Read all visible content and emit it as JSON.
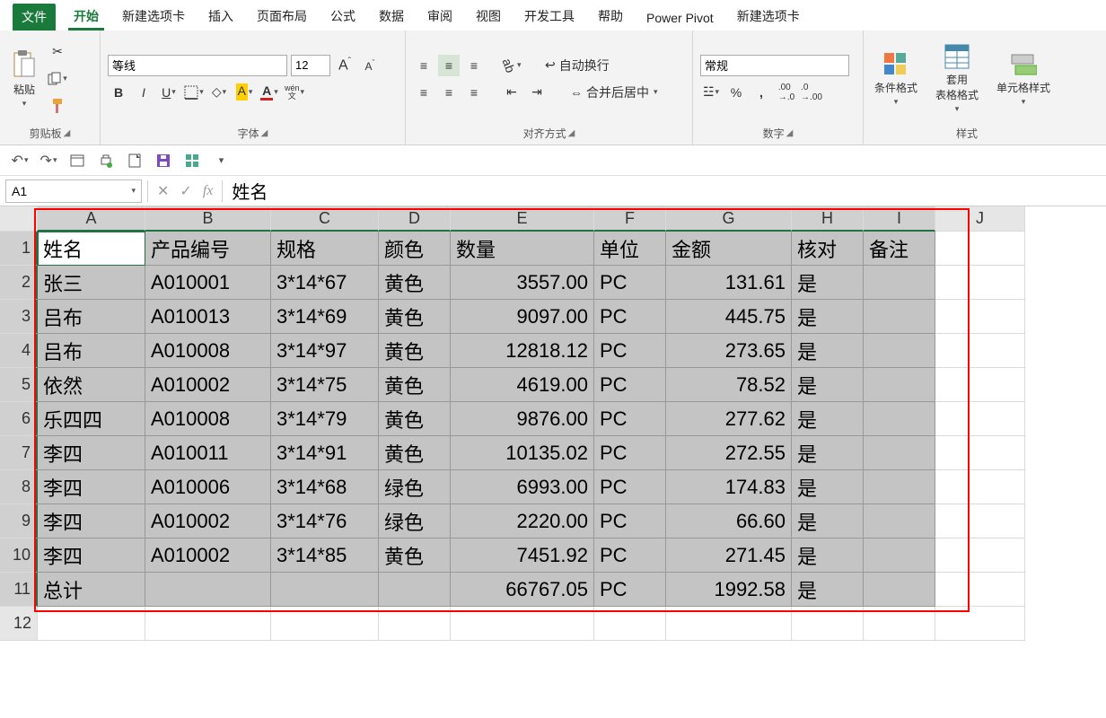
{
  "menu": {
    "file": "文件",
    "home": "开始",
    "newtab1": "新建选项卡",
    "insert": "插入",
    "layout": "页面布局",
    "formula": "公式",
    "data": "数据",
    "review": "审阅",
    "view": "视图",
    "dev": "开发工具",
    "help": "帮助",
    "powerpivot": "Power Pivot",
    "newtab2": "新建选项卡"
  },
  "ribbon": {
    "clipboard": {
      "label": "剪贴板",
      "paste": "粘贴"
    },
    "font": {
      "label": "字体",
      "name": "等线",
      "size": "12",
      "bold": "B",
      "italic": "I",
      "underline": "U",
      "wen": "wén",
      "wen2": "文"
    },
    "align": {
      "label": "对齐方式",
      "wrap": "自动换行",
      "merge": "合并后居中"
    },
    "number": {
      "label": "数字",
      "format": "常规"
    },
    "styles": {
      "label": "样式",
      "cond": "条件格式",
      "table": "套用\n表格格式",
      "cell": "单元格样式"
    }
  },
  "qat": {
    "items": [
      "undo",
      "redo",
      "save-mode",
      "touch",
      "new",
      "save",
      "grid",
      "more"
    ]
  },
  "namebox": "A1",
  "formula": "姓名",
  "columns": [
    "A",
    "B",
    "C",
    "D",
    "E",
    "F",
    "G",
    "H",
    "I",
    "J"
  ],
  "headers": [
    "姓名",
    "产品编号",
    "规格",
    "颜色",
    "数量",
    "单位",
    "金额",
    "核对",
    "备注"
  ],
  "rows": [
    {
      "r": 2,
      "c": [
        "张三",
        "A010001",
        "3*14*67",
        "黄色",
        "3557.00",
        "PC",
        "131.61",
        "是",
        ""
      ]
    },
    {
      "r": 3,
      "c": [
        "吕布",
        "A010013",
        "3*14*69",
        "黄色",
        "9097.00",
        "PC",
        "445.75",
        "是",
        ""
      ]
    },
    {
      "r": 4,
      "c": [
        "吕布",
        "A010008",
        "3*14*97",
        "黄色",
        "12818.12",
        "PC",
        "273.65",
        "是",
        ""
      ]
    },
    {
      "r": 5,
      "c": [
        "依然",
        "A010002",
        "3*14*75",
        "黄色",
        "4619.00",
        "PC",
        "78.52",
        "是",
        ""
      ]
    },
    {
      "r": 6,
      "c": [
        "乐四四",
        "A010008",
        "3*14*79",
        "黄色",
        "9876.00",
        "PC",
        "277.62",
        "是",
        ""
      ]
    },
    {
      "r": 7,
      "c": [
        "李四",
        "A010011",
        "3*14*91",
        "黄色",
        "10135.02",
        "PC",
        "272.55",
        "是",
        ""
      ]
    },
    {
      "r": 8,
      "c": [
        "李四",
        "A010006",
        "3*14*68",
        "绿色",
        "6993.00",
        "PC",
        "174.83",
        "是",
        ""
      ]
    },
    {
      "r": 9,
      "c": [
        "李四",
        "A010002",
        "3*14*76",
        "绿色",
        "2220.00",
        "PC",
        "66.60",
        "是",
        ""
      ]
    },
    {
      "r": 10,
      "c": [
        "李四",
        "A010002",
        "3*14*85",
        "黄色",
        "7451.92",
        "PC",
        "271.45",
        "是",
        ""
      ]
    },
    {
      "r": 11,
      "c": [
        "总计",
        "",
        "",
        "",
        "66767.05",
        "PC",
        "1992.58",
        "是",
        ""
      ]
    }
  ],
  "chart_data": {
    "type": "table",
    "columns": [
      "姓名",
      "产品编号",
      "规格",
      "颜色",
      "数量",
      "单位",
      "金额",
      "核对",
      "备注"
    ],
    "rows": [
      [
        "张三",
        "A010001",
        "3*14*67",
        "黄色",
        3557.0,
        "PC",
        131.61,
        "是",
        ""
      ],
      [
        "吕布",
        "A010013",
        "3*14*69",
        "黄色",
        9097.0,
        "PC",
        445.75,
        "是",
        ""
      ],
      [
        "吕布",
        "A010008",
        "3*14*97",
        "黄色",
        12818.12,
        "PC",
        273.65,
        "是",
        ""
      ],
      [
        "依然",
        "A010002",
        "3*14*75",
        "黄色",
        4619.0,
        "PC",
        78.52,
        "是",
        ""
      ],
      [
        "乐四四",
        "A010008",
        "3*14*79",
        "黄色",
        9876.0,
        "PC",
        277.62,
        "是",
        ""
      ],
      [
        "李四",
        "A010011",
        "3*14*91",
        "黄色",
        10135.02,
        "PC",
        272.55,
        "是",
        ""
      ],
      [
        "李四",
        "A010006",
        "3*14*68",
        "绿色",
        6993.0,
        "PC",
        174.83,
        "是",
        ""
      ],
      [
        "李四",
        "A010002",
        "3*14*76",
        "绿色",
        2220.0,
        "PC",
        66.6,
        "是",
        ""
      ],
      [
        "李四",
        "A010002",
        "3*14*85",
        "黄色",
        7451.92,
        "PC",
        271.45,
        "是",
        ""
      ],
      [
        "总计",
        "",
        "",
        "",
        66767.05,
        "PC",
        1992.58,
        "是",
        ""
      ]
    ]
  }
}
